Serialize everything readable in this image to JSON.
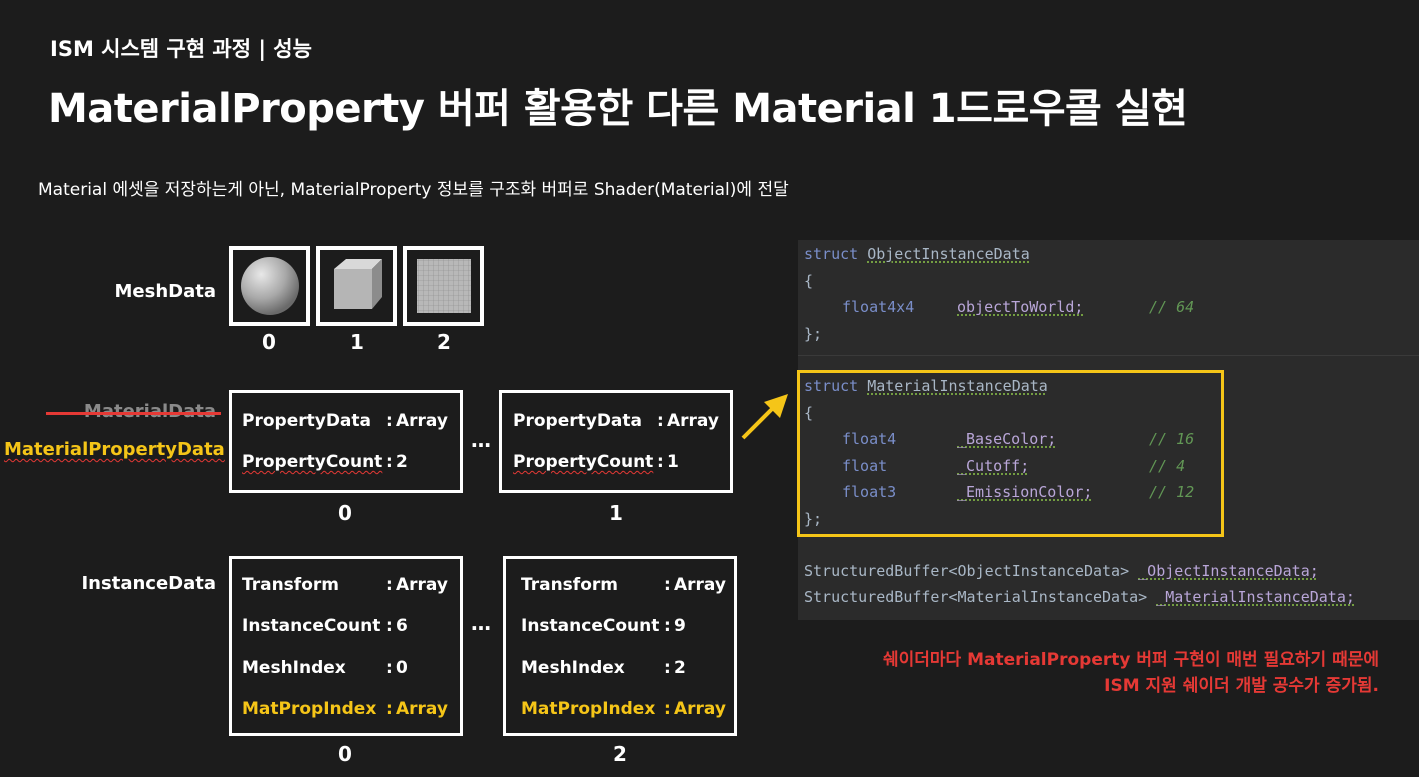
{
  "header": {
    "subtitle": "ISM 시스템 구현 과정 | 성능",
    "title": "MaterialProperty 버퍼 활용한 다른 Material 1드로우콜 실현",
    "description": "Material 에셋을 저장하는게 아닌, MaterialProperty 정보를 구조화 버퍼로 Shader(Material)에 전달"
  },
  "mesh_row": {
    "label": "MeshData",
    "items": [
      {
        "index": "0",
        "shape": "sphere-icon"
      },
      {
        "index": "1",
        "shape": "cube-icon"
      },
      {
        "index": "2",
        "shape": "plane-icon"
      }
    ]
  },
  "material_row": {
    "old_label": "MaterialData",
    "new_label": "MaterialPropertyData",
    "ellipsis": "…",
    "boxes": [
      {
        "index": "0",
        "fields": [
          {
            "key": "PropertyData",
            "sep": ":",
            "value": "Array"
          },
          {
            "key": "PropertyCount",
            "sep": ":",
            "value": "2"
          }
        ]
      },
      {
        "index": "1",
        "fields": [
          {
            "key": "PropertyData",
            "sep": ":",
            "value": "Array"
          },
          {
            "key": "PropertyCount",
            "sep": ":",
            "value": "1"
          }
        ]
      }
    ]
  },
  "instance_row": {
    "label": "InstanceData",
    "ellipsis": "…",
    "boxes": [
      {
        "index": "0",
        "fields": [
          {
            "key": "Transform",
            "sep": ":",
            "value": "Array"
          },
          {
            "key": "InstanceCount",
            "sep": ":",
            "value": "6"
          },
          {
            "key": "MeshIndex",
            "sep": ":",
            "value": "0"
          },
          {
            "key": "MatPropIndex",
            "sep": ":",
            "value": "Array"
          }
        ]
      },
      {
        "index": "2",
        "fields": [
          {
            "key": "Transform",
            "sep": ":",
            "value": "Array"
          },
          {
            "key": "InstanceCount",
            "sep": ":",
            "value": "9"
          },
          {
            "key": "MeshIndex",
            "sep": ":",
            "value": "2"
          },
          {
            "key": "MatPropIndex",
            "sep": ":",
            "value": "Array"
          }
        ]
      }
    ]
  },
  "code": {
    "struct1": {
      "keyword": "struct",
      "name": "ObjectInstanceData",
      "open": "{",
      "close": "};",
      "fields": [
        {
          "type": "float4x4",
          "name": "objectToWorld;",
          "comment": "// 64"
        }
      ]
    },
    "struct2": {
      "keyword": "struct",
      "name": "MaterialInstanceData",
      "open": "{",
      "close": "};",
      "fields": [
        {
          "type": "float4",
          "name": "_BaseColor;",
          "comment": "// 16"
        },
        {
          "type": "float",
          "name": "_Cutoff;",
          "comment": "// 4"
        },
        {
          "type": "float3",
          "name": "_EmissionColor;",
          "comment": "// 12"
        }
      ]
    },
    "buffer1": {
      "type": "StructuredBuffer<ObjectInstanceData>",
      "name": "_ObjectInstanceData;"
    },
    "buffer2": {
      "type": "StructuredBuffer<MaterialInstanceData>",
      "name": "_MaterialInstanceData;"
    }
  },
  "warning": {
    "line1": "쉐이더마다 MaterialProperty 버퍼 구현이 매번 필요하기 때문에",
    "line2": "ISM 지원 쉐이더 개발 공수가 증가됨."
  },
  "colors": {
    "accent": "#f5c518",
    "warning": "#e53935",
    "background": "#1c1c1c",
    "code_bg": "#2b2b2b"
  }
}
